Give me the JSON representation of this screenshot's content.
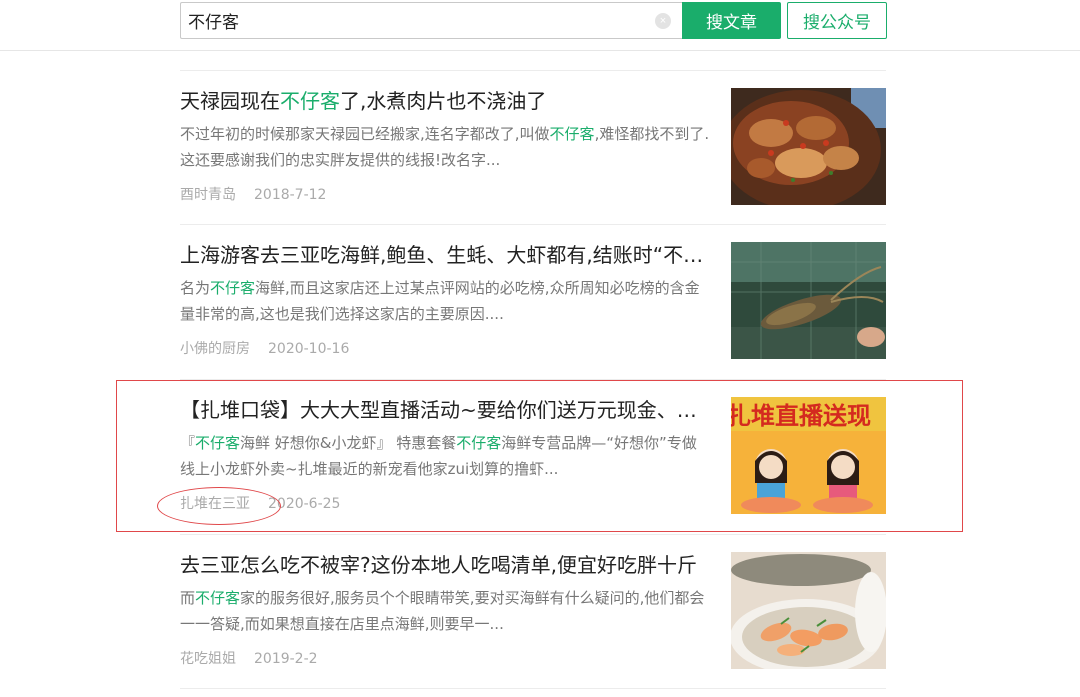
{
  "search": {
    "query": "不仔客",
    "clear_glyph": "×",
    "article_button": "搜文章",
    "account_button": "搜公众号"
  },
  "results": [
    {
      "title_pre": "天禄园现在",
      "title_hl": "不仔客",
      "title_post": "了,水煮肉片也不浇油了",
      "desc_pre": "不过年初的时候那家天禄园已经搬家,连名字都改了,叫做",
      "desc_hl": "不仔客",
      "desc_post": ",难怪都找不到了.这还要感谢我们的忠实胖友提供的线报!改名字...",
      "account": "酉时青岛",
      "date": "2018-7-12",
      "thumb_icon": "food-photo"
    },
    {
      "title_pre": "上海游客去三亚吃海鲜,鲍鱼、生蚝、大虾都有,结账时“不仔客”",
      "title_hl": "",
      "title_post": "",
      "desc_pre": "名为",
      "desc_hl": "不仔客",
      "desc_post": "海鲜,而且这家店还上过某点评网站的必吃榜,众所周知必吃榜的含金量非常的高,这也是我们选择这家店的主要原因....",
      "account": "小佛的厨房",
      "date": "2020-10-16",
      "thumb_icon": "lobster-photo"
    },
    {
      "title_pre": "【扎堆口袋】大大大型直播活动~要给你们送万元现金、霸王餐",
      "title_hl": "",
      "title_post": "",
      "desc_pre": "『",
      "desc_hl": "不仔客",
      "desc_post": "海鲜 好想你&小龙虾』 特惠套餐",
      "desc_hl2": "不仔客",
      "desc_post2": "海鲜专营品牌—“好想你”专做线上小龙虾外卖~扎堆最近的新宠看他家zui划算的撸虾...",
      "account": "扎堆在三亚",
      "date": "2020-6-25",
      "thumb_icon": "livestream-poster",
      "thumb_text": "扎堆直播送现"
    },
    {
      "title_pre": "去三亚怎么吃不被宰?这份本地人吃喝清单,便宜好吃胖十斤",
      "title_hl": "",
      "title_post": "",
      "desc_pre": "而",
      "desc_hl": "不仔客",
      "desc_post": "家的服务很好,服务员个个眼睛带笑,要对买海鲜有什么疑问的,他们都会一一答疑,而如果想直接在店里点海鲜,则要早一...",
      "account": "花吃姐姐",
      "date": "2019-2-2",
      "thumb_icon": "seafood-plate-photo"
    }
  ],
  "colors": {
    "accent": "#1aad6b",
    "annotation": "#e0484a"
  }
}
